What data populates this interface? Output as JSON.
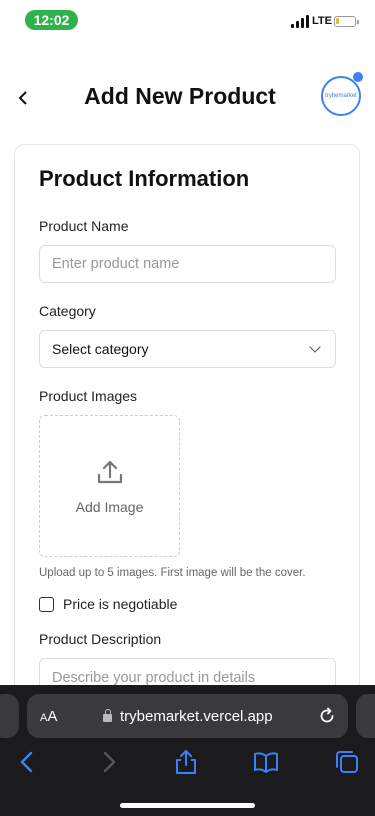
{
  "status_bar": {
    "time": "12:02",
    "network": "LTE",
    "battery_level": 0.2,
    "battery_color": "#e7b83a",
    "time_pill_color": "#2fb24b"
  },
  "header": {
    "back_icon": "chevron-left-icon",
    "title": "Add New Product",
    "avatar_text": "trybemarket",
    "accent_color": "#3b82f6"
  },
  "form": {
    "section_title": "Product Information",
    "product_name": {
      "label": "Product Name",
      "placeholder": "Enter product name",
      "value": ""
    },
    "category": {
      "label": "Category",
      "selected": "Select category"
    },
    "images": {
      "label": "Product Images",
      "add_label": "Add Image",
      "hint": "Upload up to 5 images. First image will be the cover.",
      "icon": "upload-icon"
    },
    "negotiable": {
      "label": "Price is negotiable",
      "checked": false
    },
    "description": {
      "label": "Product Description",
      "placeholder": "Describe your product in details",
      "value": ""
    }
  },
  "browser": {
    "text_size_label": "AA",
    "url": "trybemarket.vercel.app",
    "toolbar_icons": [
      "back-icon",
      "forward-icon",
      "share-icon",
      "bookmarks-icon",
      "tabs-icon"
    ],
    "toolbar_color": "#3b82f6"
  }
}
